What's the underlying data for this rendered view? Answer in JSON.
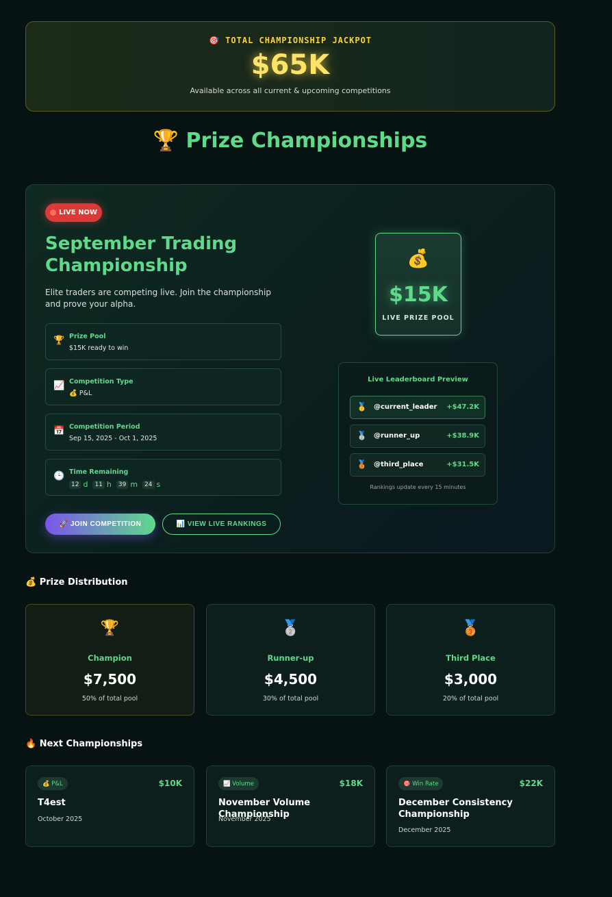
{
  "jackpot": {
    "icon": "🎯",
    "label": "TOTAL CHAMPIONSHIP JACKPOT",
    "amount": "$65K",
    "subtitle": "Available across all current & upcoming competitions"
  },
  "page": {
    "icon": "🏆",
    "title": "Prize Championships"
  },
  "live": {
    "badge": "LIVE NOW",
    "title": "September Trading Championship",
    "description": "Elite traders are competing live. Join the championship and prove your alpha.",
    "info": [
      {
        "icon": "trophy-icon",
        "glyph": "🏆",
        "label": "Prize Pool",
        "value": "$15K ready to win"
      },
      {
        "icon": "chart-line-icon",
        "glyph": "📈",
        "label": "Competition Type",
        "value": "💰 P&L"
      },
      {
        "icon": "calendar-icon",
        "glyph": "📅",
        "label": "Competition Period",
        "value": "Sep 15, 2025 - Oct 1, 2025"
      },
      {
        "icon": "clock-icon",
        "glyph": "🕒",
        "label": "Time Remaining",
        "value": ""
      }
    ],
    "timer": {
      "days": "12",
      "d": "d",
      "hours": "11",
      "h": "h",
      "minutes": "39",
      "m": "m",
      "seconds": "24",
      "s": "s"
    },
    "join_button": "🚀 JOIN COMPETITION",
    "rankings_button": "📊 VIEW LIVE RANKINGS",
    "pool": {
      "icon": "💰",
      "amount": "$15K",
      "label": "LIVE PRIZE POOL"
    },
    "leaderboard": {
      "title": "Live Leaderboard Preview",
      "rows": [
        {
          "medal": "🥇",
          "user": "@current_leader",
          "value": "+$47.2K"
        },
        {
          "medal": "🥈",
          "user": "@runner_up",
          "value": "+$38.9K"
        },
        {
          "medal": "🥉",
          "user": "@third_place",
          "value": "+$31.5K"
        }
      ],
      "footer": "Rankings update every 15 minutes"
    }
  },
  "distribution": {
    "title": "💰 Prize Distribution",
    "prizes": [
      {
        "icon": "🏆",
        "label": "Champion",
        "amount": "$7,500",
        "pct": "50% of total pool"
      },
      {
        "icon": "🥈",
        "label": "Runner-up",
        "amount": "$4,500",
        "pct": "30% of total pool"
      },
      {
        "icon": "🥉",
        "label": "Third Place",
        "amount": "$3,000",
        "pct": "20% of total pool"
      }
    ]
  },
  "next": {
    "title": "🔥 Next Championships",
    "items": [
      {
        "badge": "💰 P&L",
        "amount": "$10K",
        "title": "T4est",
        "date": "October 2025"
      },
      {
        "badge": "📈 Volume",
        "amount": "$18K",
        "title": "November Volume Championship",
        "date": "November 2025"
      },
      {
        "badge": "🎯 Win Rate",
        "amount": "$22K",
        "title": "December Consistency Championship",
        "date": "December 2025"
      }
    ]
  }
}
